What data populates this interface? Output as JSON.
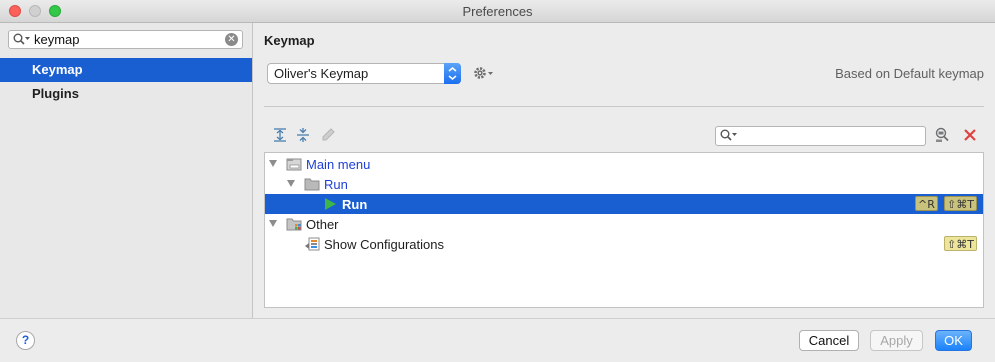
{
  "window": {
    "title": "Preferences"
  },
  "sidebar": {
    "search": {
      "value": "keymap",
      "clear_icon": "clear-icon",
      "search_icon": "search-icon"
    },
    "items": [
      {
        "label": "Keymap",
        "selected": true
      },
      {
        "label": "Plugins",
        "selected": false
      }
    ]
  },
  "main": {
    "heading": "Keymap",
    "keymap_select": {
      "value": "Oliver's Keymap"
    },
    "based_on": "Based on Default keymap",
    "toolbar": {
      "icons": [
        "expand-all-icon",
        "collapse-all-icon",
        "edit-icon"
      ],
      "filter": {
        "value": ""
      },
      "find_by_shortcut_icon": "find-shortcut-icon",
      "clear_filter_icon": "clear-filter-icon"
    },
    "tree": [
      {
        "label": "Main menu",
        "level": 0,
        "expanded": true,
        "icon": "menu-folder-icon",
        "shortcuts": []
      },
      {
        "label": "Run",
        "level": 1,
        "expanded": true,
        "icon": "folder-icon",
        "shortcuts": []
      },
      {
        "label": "Run",
        "level": 2,
        "selected": true,
        "icon": "run-icon",
        "shortcuts": [
          "^R",
          "⇧⌘T"
        ]
      },
      {
        "label": "Other",
        "level": 0,
        "expanded": true,
        "icon": "other-folder-icon",
        "shortcuts": []
      },
      {
        "label": "Show Configurations",
        "level": 1,
        "icon": "configurations-icon",
        "shortcuts": [
          "⇧⌘T"
        ]
      }
    ]
  },
  "footer": {
    "help_label": "?",
    "cancel_label": "Cancel",
    "apply_label": "Apply",
    "ok_label": "OK"
  },
  "colors": {
    "selection": "#1a5fd1",
    "link_blue": "#1d3fd8",
    "shortcut_bg": "#ede59a",
    "ok_button": "#1a82fb"
  }
}
